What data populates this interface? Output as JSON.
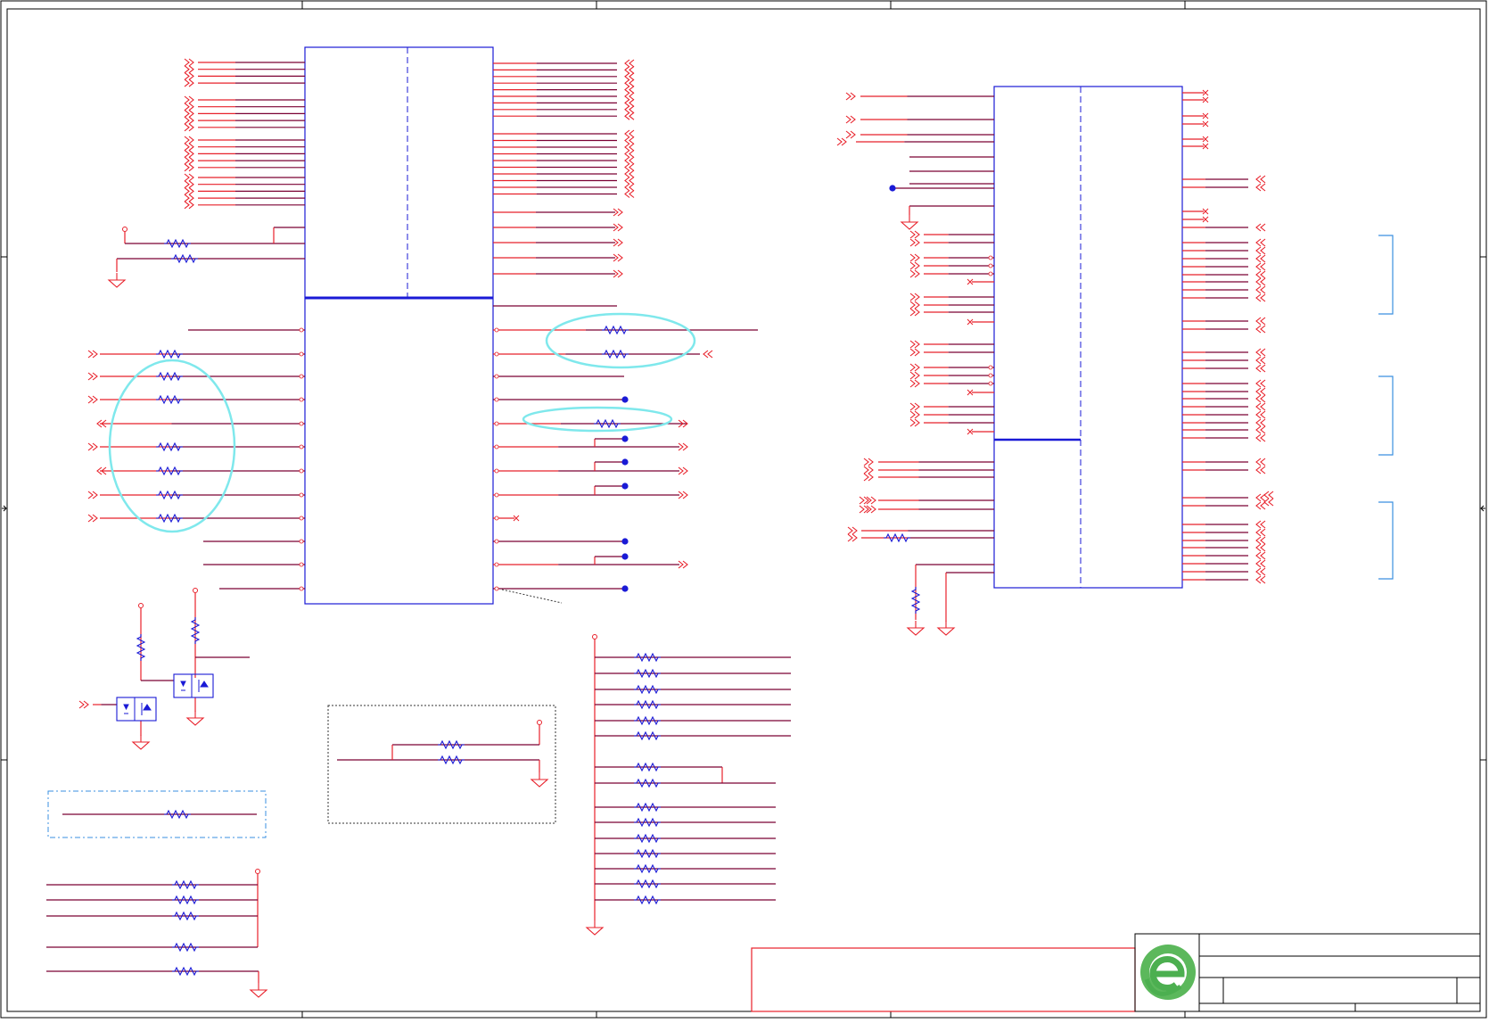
{
  "sheet": {
    "title": "",
    "colors": {
      "frame": "#000000",
      "net": "#e8202a",
      "wire": "#7a0033",
      "component": "#1a1ad6",
      "highlight": "#7fe8ec",
      "dashedGroup": "#3a8fe0",
      "logo": "#4caf50"
    },
    "icons": [
      "schematic-frame",
      "ic-symbol",
      "resistor-icon",
      "ground-icon",
      "power-flag-icon",
      "offpage-connector-icon",
      "no-connect-icon",
      "mosfet-icon",
      "company-logo-icon"
    ]
  }
}
